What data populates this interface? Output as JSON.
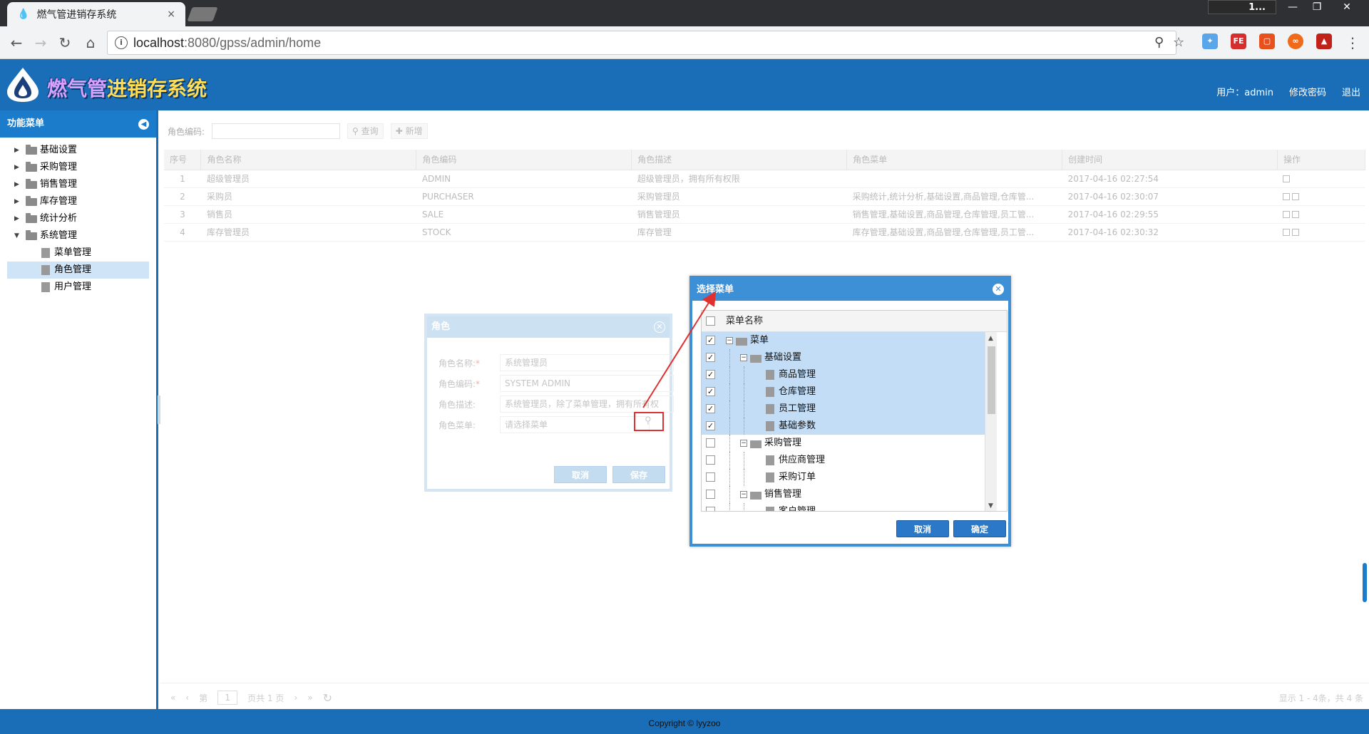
{
  "browser": {
    "tab_title": "燃气管进销存系统",
    "tab_close": "×",
    "user_badge": "1...",
    "url_host": "localhost",
    "url_rest": ":8080/gpss/admin/home",
    "win_min": "—",
    "win_restore": "❐",
    "win_close": "✕",
    "ext_fe": "FE"
  },
  "header": {
    "logo_part1": "燃气管",
    "logo_part2": "进销存系统",
    "user_label": "用户：admin",
    "change_password": "修改密码",
    "logout": "退出"
  },
  "sidebar": {
    "title": "功能菜单",
    "items": [
      {
        "label": "基础设置"
      },
      {
        "label": "采购管理"
      },
      {
        "label": "销售管理"
      },
      {
        "label": "库存管理"
      },
      {
        "label": "统计分析"
      },
      {
        "label": "系统管理"
      }
    ],
    "children": [
      {
        "label": "菜单管理"
      },
      {
        "label": "角色管理"
      },
      {
        "label": "用户管理"
      }
    ]
  },
  "toolbar": {
    "code_label": "角色编码:",
    "query": "查询",
    "add": "新增"
  },
  "grid": {
    "headers": [
      "序号",
      "角色名称",
      "角色编码",
      "角色描述",
      "角色菜单",
      "创建时间",
      "操作"
    ],
    "rows": [
      {
        "no": "1",
        "name": "超级管理员",
        "code": "ADMIN",
        "desc": "超级管理员，拥有所有权限",
        "menu": "",
        "time": "2017-04-16 02:27:54"
      },
      {
        "no": "2",
        "name": "采购员",
        "code": "PURCHASER",
        "desc": "采购管理员",
        "menu": "采购统计,统计分析,基础设置,商品管理,仓库管...",
        "time": "2017-04-16 02:30:07"
      },
      {
        "no": "3",
        "name": "销售员",
        "code": "SALE",
        "desc": "销售管理员",
        "menu": "销售管理,基础设置,商品管理,仓库管理,员工管...",
        "time": "2017-04-16 02:29:55"
      },
      {
        "no": "4",
        "name": "库存管理员",
        "code": "STOCK",
        "desc": "库存管理",
        "menu": "库存管理,基础设置,商品管理,仓库管理,员工管...",
        "time": "2017-04-16 02:30:32"
      }
    ]
  },
  "pager": {
    "page_prefix": "第",
    "page_value": "1",
    "page_suffix": "页共 1 页",
    "summary": "显示 1 - 4条，共 4 条"
  },
  "footer": {
    "text": "Copyright © lyyzoo"
  },
  "role_dialog": {
    "title": "角色",
    "name_label": "角色名称:",
    "name_value": "系统管理员",
    "code_label": "角色编码:",
    "code_value": "SYSTEM ADMIN",
    "desc_label": "角色描述:",
    "desc_value": "系统管理员，除了菜单管理，拥有所有权",
    "menu_label": "角色菜单:",
    "menu_placeholder": "请选择菜单",
    "required_mark": "*",
    "cancel": "取消",
    "save": "保存"
  },
  "menu_dialog": {
    "title": "选择菜单",
    "column": "菜单名称",
    "rows": [
      {
        "label": "菜单",
        "checked": "✓"
      },
      {
        "label": "基础设置",
        "checked": "✓"
      },
      {
        "label": "商品管理",
        "checked": "✓"
      },
      {
        "label": "仓库管理",
        "checked": "✓"
      },
      {
        "label": "员工管理",
        "checked": "✓"
      },
      {
        "label": "基础参数",
        "checked": "✓"
      },
      {
        "label": "采购管理",
        "checked": ""
      },
      {
        "label": "供应商管理",
        "checked": ""
      },
      {
        "label": "采购订单",
        "checked": ""
      },
      {
        "label": "销售管理",
        "checked": ""
      },
      {
        "label": "客户管理",
        "checked": ""
      }
    ],
    "cancel": "取消",
    "confirm": "确定"
  },
  "colors": {
    "brand_blue": "#1a6eb8",
    "dialog_blue": "#3d8fd6",
    "selection": "#c2ddf5",
    "annotation_red": "#e03030"
  }
}
